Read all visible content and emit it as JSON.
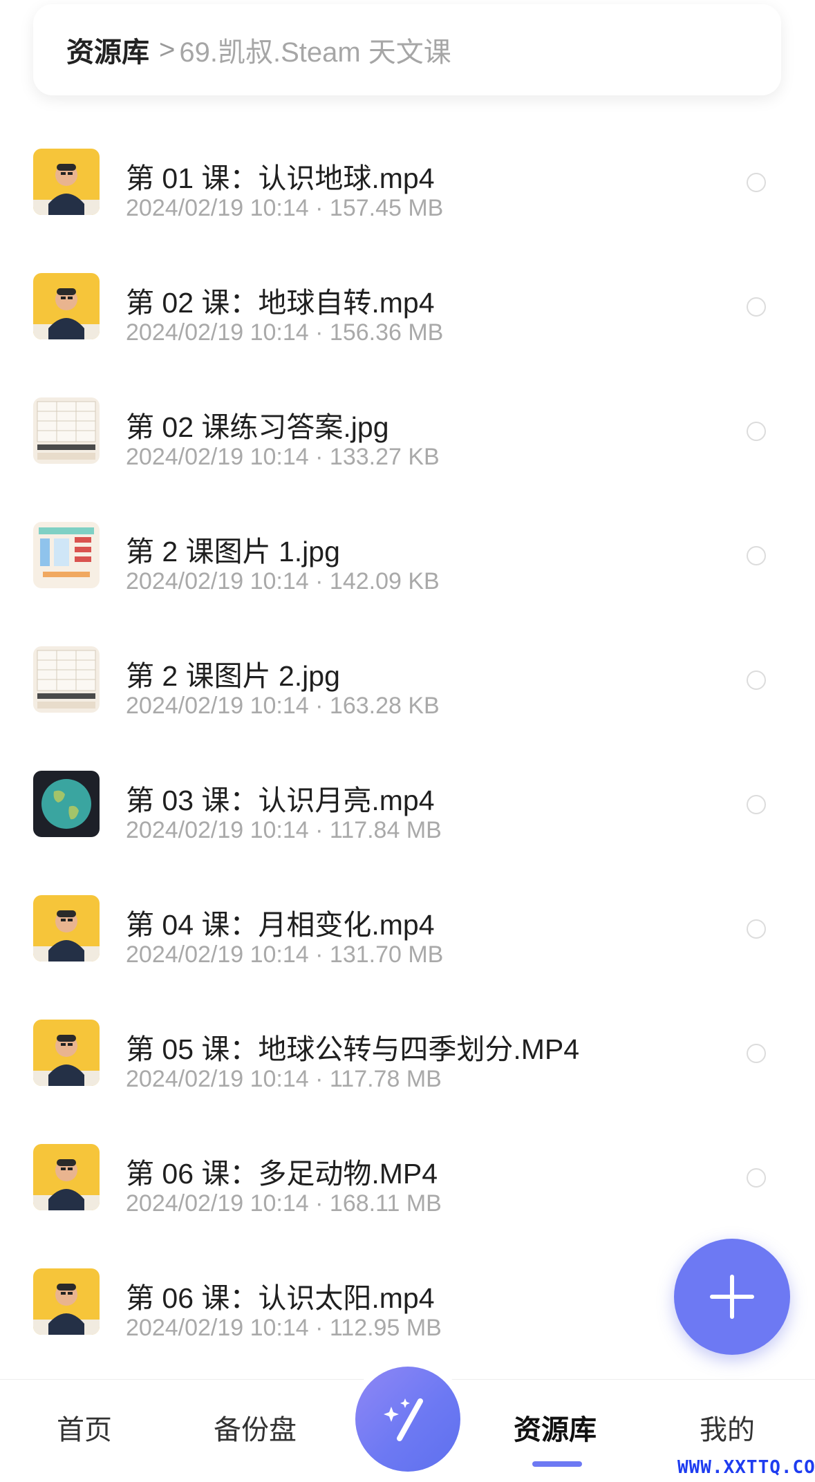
{
  "breadcrumb": {
    "root": "资源库",
    "separator": ">",
    "current": "69.凯叔.Steam 天文课"
  },
  "files": [
    {
      "name": "第 01 课：认识地球.mp4",
      "meta": "2024/02/19 10:14 · 157.45 MB",
      "thumb": "video"
    },
    {
      "name": "第 02 课：地球自转.mp4",
      "meta": "2024/02/19 10:14 · 156.36 MB",
      "thumb": "video"
    },
    {
      "name": "第 02 课练习答案.jpg",
      "meta": "2024/02/19 10:14 · 133.27 KB",
      "thumb": "worksheet"
    },
    {
      "name": "第 2 课图片 1.jpg",
      "meta": "2024/02/19 10:14 · 142.09 KB",
      "thumb": "diagram"
    },
    {
      "name": "第 2 课图片 2.jpg",
      "meta": "2024/02/19 10:14 · 163.28 KB",
      "thumb": "worksheet"
    },
    {
      "name": "第 03 课：认识月亮.mp4",
      "meta": "2024/02/19 10:14 · 117.84 MB",
      "thumb": "globe"
    },
    {
      "name": "第 04 课：月相变化.mp4",
      "meta": "2024/02/19 10:14 · 131.70 MB",
      "thumb": "video"
    },
    {
      "name": "第 05 课：地球公转与四季划分.MP4",
      "meta": "2024/02/19 10:14 · 117.78 MB",
      "thumb": "video"
    },
    {
      "name": "第 06 课：多足动物.MP4",
      "meta": "2024/02/19 10:14 · 168.11 MB",
      "thumb": "video"
    },
    {
      "name": "第 06 课：认识太阳.mp4",
      "meta": "2024/02/19 10:14 · 112.95 MB",
      "thumb": "video"
    }
  ],
  "nav": {
    "home": "首页",
    "backup": "备份盘",
    "library": "资源库",
    "mine": "我的",
    "active": "library"
  },
  "icons": {
    "fab": "plus-icon",
    "center": "magic-wand-icon",
    "select": "radio-circle-icon"
  },
  "colors": {
    "accent": "#6d79f3",
    "thumb_yellow": "#f6c53a",
    "watermark": "#1e3cf0"
  },
  "watermark": "WWW.XXTTQ.COM"
}
